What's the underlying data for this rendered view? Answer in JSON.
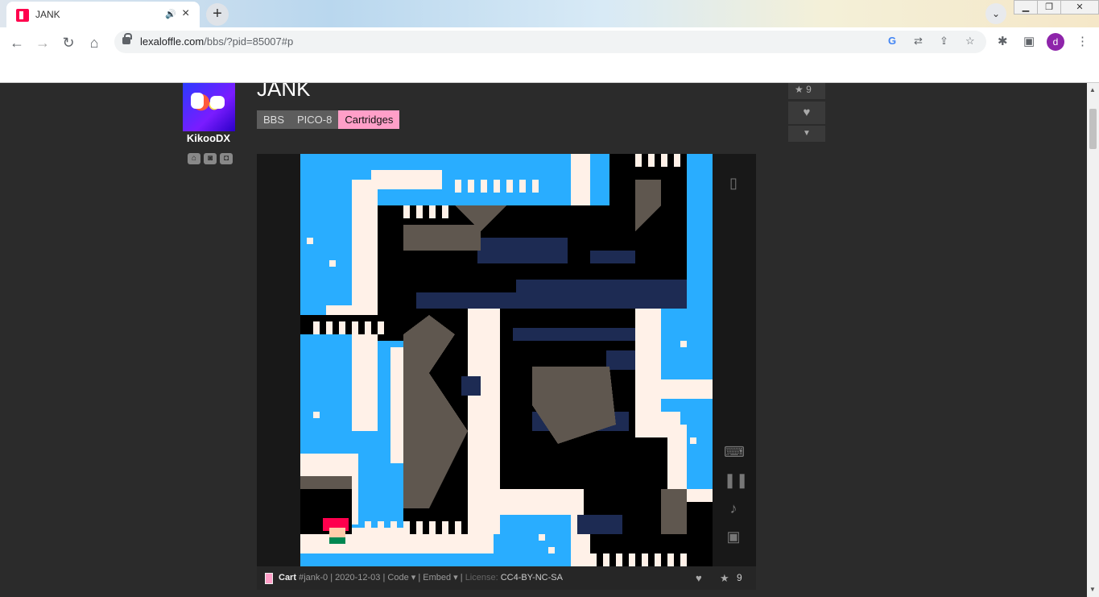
{
  "browser": {
    "tab_title": "JANK",
    "new_tab": "+",
    "url_host": "lexaloffle.com",
    "url_path": "/bbs/?pid=85007#p",
    "profile_initial": "d"
  },
  "post": {
    "author": "KikooDX",
    "title": "JANK",
    "breadcrumbs": [
      "BBS",
      "PICO-8",
      "Cartridges"
    ],
    "star_count": "9"
  },
  "cart_footer": {
    "cart_label": "Cart",
    "cart_id": "#jank-0",
    "date": "2020-12-03",
    "code_label": "Code ▾",
    "embed_label": "Embed ▾",
    "license_label": "License:",
    "license_value": "CC4-BY-NC-SA",
    "star_count": "9"
  },
  "colors": {
    "accent_pink": "#ff9fc8",
    "pico_blue": "#29adff",
    "pico_dark_blue": "#1d2b53",
    "pico_gray": "#5f574f",
    "pico_white": "#fff1e8",
    "pico_red": "#ff004d"
  }
}
